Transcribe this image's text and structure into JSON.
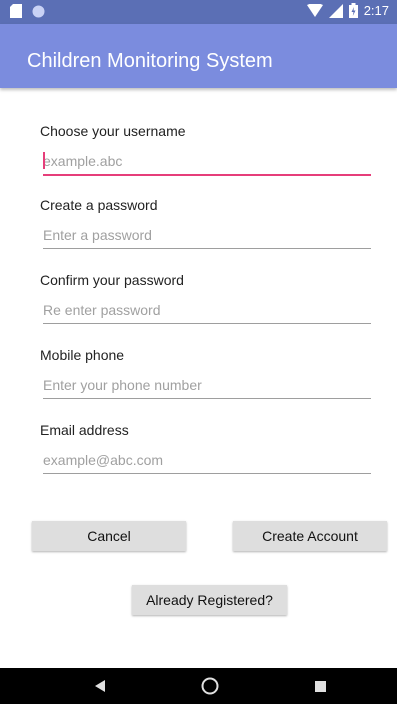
{
  "status_bar": {
    "time": "2:17"
  },
  "app_bar": {
    "title": "Children Monitoring System"
  },
  "form": {
    "username": {
      "label": "Choose your username",
      "placeholder": "example.abc"
    },
    "password": {
      "label": "Create a password",
      "placeholder": "Enter a password"
    },
    "confirm_password": {
      "label": "Confirm your password",
      "placeholder": "Re enter password"
    },
    "mobile": {
      "label": "Mobile phone",
      "placeholder": "Enter your phone number"
    },
    "email": {
      "label": "Email address",
      "placeholder": "example@abc.com"
    }
  },
  "buttons": {
    "cancel": "Cancel",
    "create_account": "Create Account",
    "already_registered": "Already Registered?"
  },
  "colors": {
    "status_bar": "#5b6fb5",
    "app_bar": "#7b8cde",
    "accent": "#e63e7a"
  }
}
